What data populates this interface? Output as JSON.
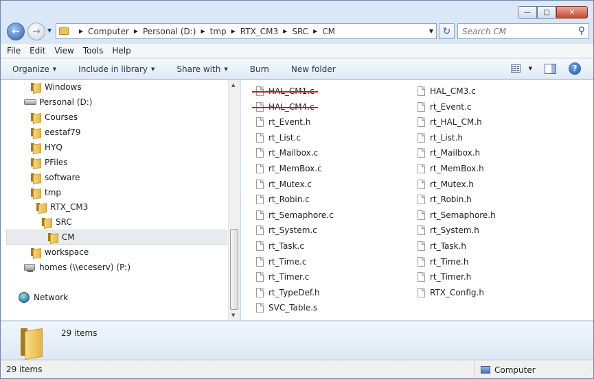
{
  "window": {
    "caption_buttons": {
      "minimize": "—",
      "maximize": "□",
      "close": "✕"
    }
  },
  "address_bar": {
    "crumbs": [
      "Computer",
      "Personal (D:)",
      "tmp",
      "RTX_CM3",
      "SRC",
      "CM"
    ],
    "search_placeholder": "Search CM"
  },
  "menu": [
    "File",
    "Edit",
    "View",
    "Tools",
    "Help"
  ],
  "toolbar": {
    "organize": "Organize",
    "include_in_library": "Include in library",
    "share_with": "Share with",
    "burn": "Burn",
    "new_folder": "New folder",
    "help": "?"
  },
  "nav_tree": [
    {
      "label": "Windows",
      "icon": "folder-icon"
    },
    {
      "label": "Personal (D:)",
      "icon": "drive-icon"
    },
    {
      "label": "Courses",
      "icon": "folder-icon"
    },
    {
      "label": "eestaf79",
      "icon": "folder-icon"
    },
    {
      "label": "HYQ",
      "icon": "folder-icon"
    },
    {
      "label": "PFiles",
      "icon": "folder-icon"
    },
    {
      "label": "software",
      "icon": "folder-icon"
    },
    {
      "label": "tmp",
      "icon": "folder-icon"
    },
    {
      "label": "RTX_CM3",
      "icon": "folder-icon"
    },
    {
      "label": "SRC",
      "icon": "folder-icon"
    },
    {
      "label": "CM",
      "icon": "folder-icon",
      "selected": true
    },
    {
      "label": "workspace",
      "icon": "folder-icon"
    },
    {
      "label": "homes (\\\\eceserv) (P:)",
      "icon": "network-drive-icon"
    },
    {
      "label": "Network",
      "icon": "network-icon"
    }
  ],
  "files_col1": [
    {
      "name": "HAL_CM1.c",
      "struck": true
    },
    {
      "name": "HAL_CM4.c",
      "struck": true
    },
    {
      "name": "rt_Event.h"
    },
    {
      "name": "rt_List.c"
    },
    {
      "name": "rt_Mailbox.c"
    },
    {
      "name": "rt_MemBox.c"
    },
    {
      "name": "rt_Mutex.c"
    },
    {
      "name": "rt_Robin.c"
    },
    {
      "name": "rt_Semaphore.c"
    },
    {
      "name": "rt_System.c"
    },
    {
      "name": "rt_Task.c"
    },
    {
      "name": "rt_Time.c"
    },
    {
      "name": "rt_Timer.c"
    },
    {
      "name": "rt_TypeDef.h"
    },
    {
      "name": "SVC_Table.s"
    }
  ],
  "files_col2": [
    {
      "name": "HAL_CM3.c"
    },
    {
      "name": "rt_Event.c"
    },
    {
      "name": "rt_HAL_CM.h"
    },
    {
      "name": "rt_List.h"
    },
    {
      "name": "rt_Mailbox.h"
    },
    {
      "name": "rt_MemBox.h"
    },
    {
      "name": "rt_Mutex.h"
    },
    {
      "name": "rt_Robin.h"
    },
    {
      "name": "rt_Semaphore.h"
    },
    {
      "name": "rt_System.h"
    },
    {
      "name": "rt_Task.h"
    },
    {
      "name": "rt_Time.h"
    },
    {
      "name": "rt_Timer.h"
    },
    {
      "name": "RTX_Config.h"
    }
  ],
  "details_pane": {
    "count": "29 items"
  },
  "status_bar": {
    "count": "29 items",
    "location": "Computer"
  },
  "colors": {
    "strike": "#d01818",
    "selection": "#e8eaed"
  }
}
